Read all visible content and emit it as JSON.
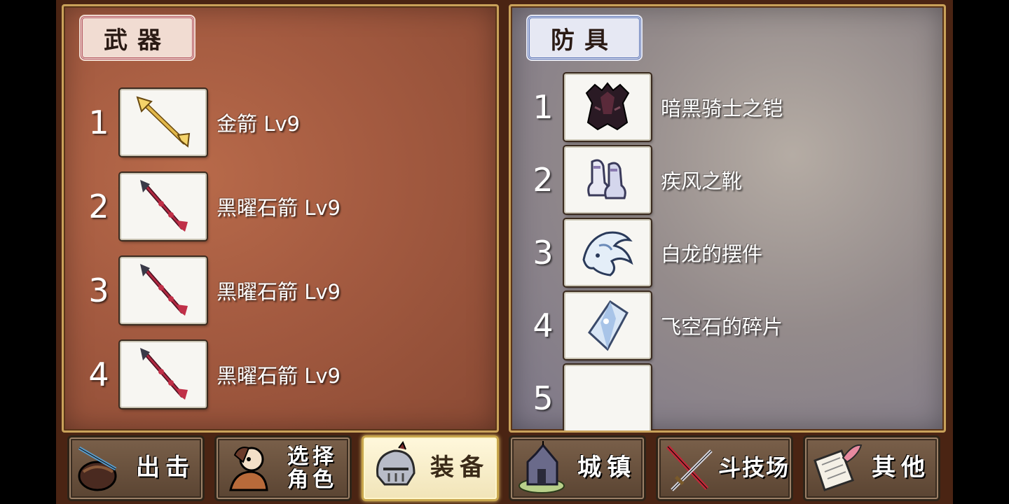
{
  "weapons": {
    "title": "武器",
    "items": [
      {
        "num": "1",
        "label": "金箭 Lv9",
        "icon": "golden-arrow-icon"
      },
      {
        "num": "2",
        "label": "黑曜石箭 Lv9",
        "icon": "obsidian-arrow-icon"
      },
      {
        "num": "3",
        "label": "黑曜石箭 Lv9",
        "icon": "obsidian-arrow-icon"
      },
      {
        "num": "4",
        "label": "黑曜石箭 Lv9",
        "icon": "obsidian-arrow-icon"
      }
    ]
  },
  "armor": {
    "title": "防具",
    "items": [
      {
        "num": "1",
        "label": "暗黑骑士之铠",
        "icon": "dark-knight-armor-icon"
      },
      {
        "num": "2",
        "label": "疾风之靴",
        "icon": "wind-boots-icon"
      },
      {
        "num": "3",
        "label": "白龙的摆件",
        "icon": "white-dragon-ornament-icon"
      },
      {
        "num": "4",
        "label": "飞空石的碎片",
        "icon": "sky-stone-shard-icon"
      },
      {
        "num": "5",
        "label": "",
        "icon": "empty-slot"
      }
    ]
  },
  "nav": {
    "sortie": "出击",
    "select_char_line1": "选择",
    "select_char_line2": "角色",
    "equip": "装备",
    "town": "城镇",
    "arena": "斗技场",
    "other": "其他",
    "active": "equip"
  }
}
